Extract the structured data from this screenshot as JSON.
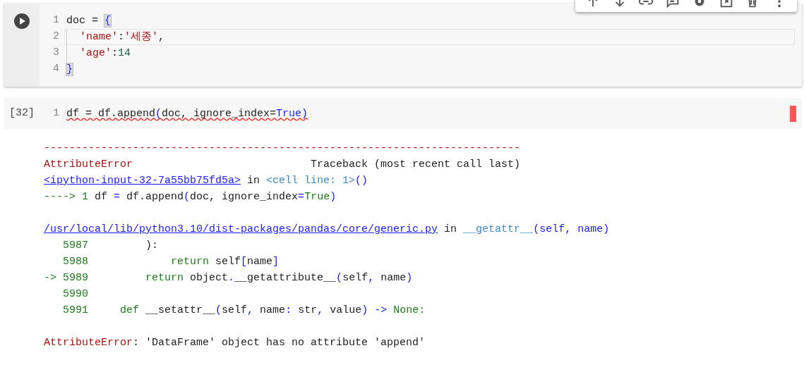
{
  "toolbar": {
    "kind": "cell-toolbar"
  },
  "cells": [
    {
      "kind": "run",
      "error_marker": false,
      "lines": [
        {
          "number": "1",
          "active": false,
          "squiggle": false,
          "indent": false,
          "tokens": [
            {
              "text": "doc = ",
              "kind": "plain"
            },
            {
              "text": "{",
              "kind": "match"
            }
          ]
        },
        {
          "number": "2",
          "active": true,
          "squiggle": false,
          "indent": true,
          "tokens": [
            {
              "text": "'name'",
              "kind": "str"
            },
            {
              "text": ":",
              "kind": "plain"
            },
            {
              "text": "'세종'",
              "kind": "str"
            },
            {
              "text": ",",
              "kind": "plain"
            }
          ]
        },
        {
          "number": "3",
          "active": false,
          "squiggle": false,
          "indent": true,
          "tokens": [
            {
              "text": "'age'",
              "kind": "str"
            },
            {
              "text": ":",
              "kind": "plain"
            },
            {
              "text": "14",
              "kind": "num"
            }
          ]
        },
        {
          "number": "4",
          "active": false,
          "squiggle": false,
          "indent": false,
          "tokens": [
            {
              "text": "}",
              "kind": "match"
            }
          ]
        }
      ]
    },
    {
      "kind": "count",
      "prompt": "[32]",
      "error_marker": true,
      "lines": [
        {
          "number": "1",
          "active": false,
          "squiggle": true,
          "indent": false,
          "tokens": [
            {
              "text": "df = df.append",
              "kind": "plain"
            },
            {
              "text": "(",
              "kind": "blue"
            },
            {
              "text": "doc, ignore_index=",
              "kind": "plain"
            },
            {
              "text": "True",
              "kind": "blue"
            },
            {
              "text": ")",
              "kind": "blue"
            }
          ]
        }
      ]
    }
  ],
  "output": {
    "blocks": [
      [
        [
          {
            "kind": "text",
            "tokens": [
              {
                "text": "---------------------------------------------------------------------------",
                "kind": "err"
              }
            ]
          }
        ],
        [
          {
            "kind": "text",
            "tokens": [
              {
                "text": "AttributeError",
                "kind": "err"
              },
              {
                "text": "                            Traceback (most recent call last)",
                "kind": "plain"
              }
            ]
          }
        ],
        [
          {
            "kind": "link",
            "text": "<ipython-input-32-7a55bb75fd5a>"
          },
          {
            "kind": "text",
            "tokens": [
              {
                "text": "in ",
                "kind": "plain"
              },
              {
                "text": "<cell line: 1>",
                "kind": "cyan"
              },
              {
                "text": "()",
                "kind": "blue"
              }
            ]
          }
        ],
        [
          {
            "kind": "text",
            "tokens": [
              {
                "text": "----> 1",
                "kind": "green"
              },
              {
                "text": " df ",
                "kind": "plain"
              },
              {
                "text": "=",
                "kind": "blue"
              },
              {
                "text": " df.append",
                "kind": "plain"
              },
              {
                "text": "(",
                "kind": "blue"
              },
              {
                "text": "doc, ignore_index",
                "kind": "plain"
              },
              {
                "text": "=",
                "kind": "blue"
              },
              {
                "text": "True",
                "kind": "green"
              },
              {
                "text": ")",
                "kind": "blue"
              }
            ]
          }
        ]
      ],
      [
        [
          {
            "kind": "link",
            "text": "/usr/local/lib/python3.10/dist-packages/pandas/core/generic.py"
          },
          {
            "kind": "text",
            "tokens": [
              {
                "text": "in ",
                "kind": "plain"
              },
              {
                "text": "__getattr__",
                "kind": "cyan"
              },
              {
                "text": "(self, name)",
                "kind": "blue"
              }
            ]
          }
        ],
        [
          {
            "kind": "text",
            "tokens": [
              {
                "text": "   5987",
                "kind": "green"
              },
              {
                "text": "         ):",
                "kind": "plain"
              }
            ]
          }
        ],
        [
          {
            "kind": "text",
            "tokens": [
              {
                "text": "   5988",
                "kind": "green"
              },
              {
                "text": "             return",
                "kind": "green"
              },
              {
                "text": " self",
                "kind": "plain"
              },
              {
                "text": "[",
                "kind": "blue"
              },
              {
                "text": "name",
                "kind": "plain"
              },
              {
                "text": "]",
                "kind": "blue"
              }
            ]
          }
        ],
        [
          {
            "kind": "text",
            "tokens": [
              {
                "text": "-> 5989",
                "kind": "green"
              },
              {
                "text": "         return",
                "kind": "green"
              },
              {
                "text": " object",
                "kind": "plain"
              },
              {
                "text": ".",
                "kind": "blue"
              },
              {
                "text": "__getattribute__",
                "kind": "plain"
              },
              {
                "text": "(",
                "kind": "blue"
              },
              {
                "text": "self",
                "kind": "plain"
              },
              {
                "text": ",",
                "kind": "blue"
              },
              {
                "text": " name",
                "kind": "plain"
              },
              {
                "text": ")",
                "kind": "blue"
              }
            ]
          }
        ],
        [
          {
            "kind": "text",
            "tokens": [
              {
                "text": "   5990",
                "kind": "green"
              }
            ]
          }
        ],
        [
          {
            "kind": "text",
            "tokens": [
              {
                "text": "   5991",
                "kind": "green"
              },
              {
                "text": "     def",
                "kind": "green"
              },
              {
                "text": " __setattr__",
                "kind": "plain"
              },
              {
                "text": "(",
                "kind": "blue"
              },
              {
                "text": "self",
                "kind": "plain"
              },
              {
                "text": ",",
                "kind": "blue"
              },
              {
                "text": " name",
                "kind": "plain"
              },
              {
                "text": ":",
                "kind": "blue"
              },
              {
                "text": " str",
                "kind": "plain"
              },
              {
                "text": ",",
                "kind": "blue"
              },
              {
                "text": " value",
                "kind": "plain"
              },
              {
                "text": ")",
                "kind": "blue"
              },
              {
                "text": " ->",
                "kind": "blue"
              },
              {
                "text": " None:",
                "kind": "green"
              }
            ]
          }
        ]
      ],
      [
        [
          {
            "kind": "text",
            "tokens": [
              {
                "text": "AttributeError",
                "kind": "err"
              },
              {
                "text": ": 'DataFrame' object has no attribute 'append'",
                "kind": "plain"
              }
            ]
          }
        ]
      ]
    ]
  }
}
